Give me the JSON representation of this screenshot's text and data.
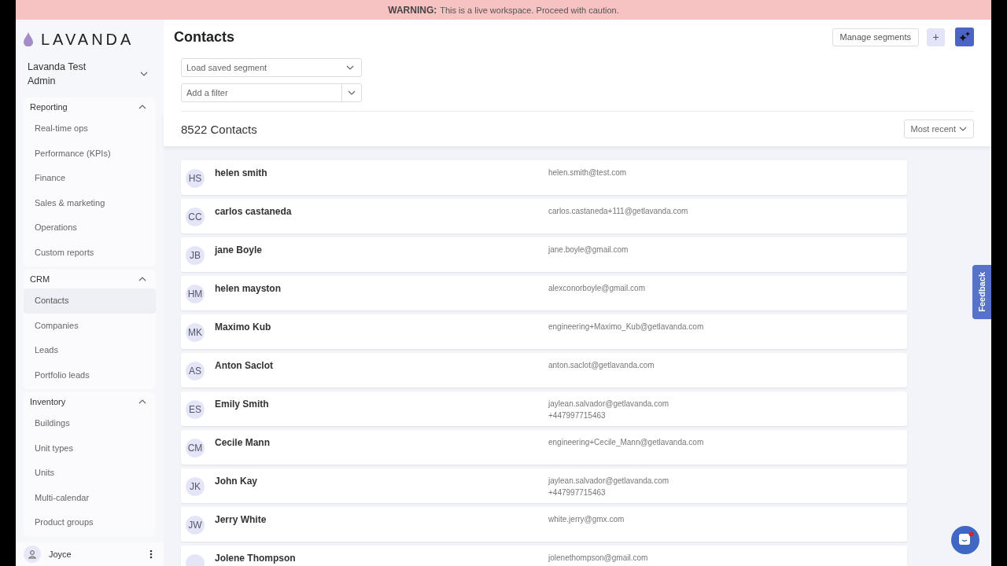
{
  "banner": {
    "label": "WARNING:",
    "message": "This is a live workspace. Proceed with caution."
  },
  "sidebar": {
    "logo": "LAVANDA",
    "workspace": {
      "name": "Lavanda Test",
      "role": "Admin"
    },
    "sections": [
      {
        "title": "Reporting",
        "expanded": true,
        "items": [
          {
            "label": "Real-time ops",
            "selected": false
          },
          {
            "label": "Performance (KPIs)",
            "selected": false
          },
          {
            "label": "Finance",
            "selected": false
          },
          {
            "label": "Sales & marketing",
            "selected": false
          },
          {
            "label": "Operations",
            "selected": false
          },
          {
            "label": "Custom reports",
            "selected": false
          }
        ]
      },
      {
        "title": "CRM",
        "expanded": true,
        "items": [
          {
            "label": "Contacts",
            "selected": true
          },
          {
            "label": "Companies",
            "selected": false
          },
          {
            "label": "Leads",
            "selected": false
          },
          {
            "label": "Portfolio leads",
            "selected": false
          }
        ]
      },
      {
        "title": "Inventory",
        "expanded": true,
        "items": [
          {
            "label": "Buildings",
            "selected": false
          },
          {
            "label": "Unit types",
            "selected": false
          },
          {
            "label": "Units",
            "selected": false
          },
          {
            "label": "Multi-calendar",
            "selected": false
          },
          {
            "label": "Product groups",
            "selected": false
          }
        ]
      }
    ],
    "user": {
      "name": "Joyce"
    }
  },
  "header": {
    "title": "Contacts",
    "manage_button": "Manage segments",
    "plus_button": "+",
    "segment_select": {
      "placeholder": "Load saved segment"
    },
    "filter": {
      "placeholder": "Add a filter"
    }
  },
  "list": {
    "count": "8522 Contacts",
    "sort": "Most recent",
    "contacts": [
      {
        "initials": "HS",
        "name": "helen smith",
        "lines": [
          "helen.smith@test.com"
        ]
      },
      {
        "initials": "CC",
        "name": "carlos castaneda",
        "lines": [
          "carlos.castaneda+111@getlavanda.com"
        ]
      },
      {
        "initials": "JB",
        "name": "jane Boyle",
        "lines": [
          "jane.boyle@gmail.com"
        ]
      },
      {
        "initials": "HM",
        "name": "helen mayston",
        "lines": [
          "alexconorboyle@gmail.com"
        ]
      },
      {
        "initials": "MK",
        "name": "Maximo Kub",
        "lines": [
          "engineering+Maximo_Kub@getlavanda.com"
        ]
      },
      {
        "initials": "AS",
        "name": "Anton Saclot",
        "lines": [
          "anton.saclot@getlavanda.com"
        ]
      },
      {
        "initials": "ES",
        "name": "Emily Smith",
        "lines": [
          "jaylean.salvador@getlavanda.com",
          "+447997715463"
        ]
      },
      {
        "initials": "CM",
        "name": "Cecile Mann",
        "lines": [
          "engineering+Cecile_Mann@getlavanda.com"
        ]
      },
      {
        "initials": "JK",
        "name": "John Kay",
        "lines": [
          "jaylean.salvador@getlavanda.com",
          "+447997715463"
        ]
      },
      {
        "initials": "JW",
        "name": "Jerry White",
        "lines": [
          "white.jerry@gmx.com"
        ]
      },
      {
        "name": "Jolene Thompson",
        "lines": [
          "jolenethompson@gmail.com"
        ]
      }
    ]
  },
  "feedback": "Feedback"
}
